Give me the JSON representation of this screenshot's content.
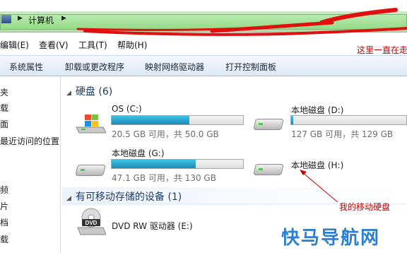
{
  "address": {
    "crumb": "计算机"
  },
  "menu": {
    "edit": "编辑(E)",
    "view": "查看(V)",
    "tools": "工具(T)",
    "help": "帮助(H)"
  },
  "notes": {
    "top": "这里一直在走",
    "drive": "我的移动硬盘"
  },
  "toolbar": {
    "props": "系统属性",
    "uninstall": "卸载或更改程序",
    "map": "映射网络驱动器",
    "panel": "打开控制面板"
  },
  "nav": [
    "夹",
    "载",
    "面",
    "最近访问的位置",
    "频",
    "片",
    "档",
    "载"
  ],
  "sections": {
    "hdd": "硬盘 (6)",
    "removable": "有可移动存储的设备 (1)"
  },
  "drives": [
    {
      "name": "OS (C:)",
      "info": "20.5 GB 可用，共 50.0 GB",
      "used": 0.59
    },
    {
      "name": "本地磁盘 (D:)",
      "info": "127 GB 可用，共 129 GB",
      "used": 0.02
    },
    {
      "name": "本地磁盘 (G:)",
      "info": "47.1 GB 可用，共 130 GB",
      "used": 0.64
    },
    {
      "name": "本地磁盘 (H:)"
    }
  ],
  "dvd": {
    "name": "DVD RW 驱动器 (E:)",
    "label": "DVD"
  },
  "watermark": "快马导航网",
  "colors": {
    "address": "#93dc86",
    "bar": "#26a0d0",
    "note": "#c00000"
  }
}
